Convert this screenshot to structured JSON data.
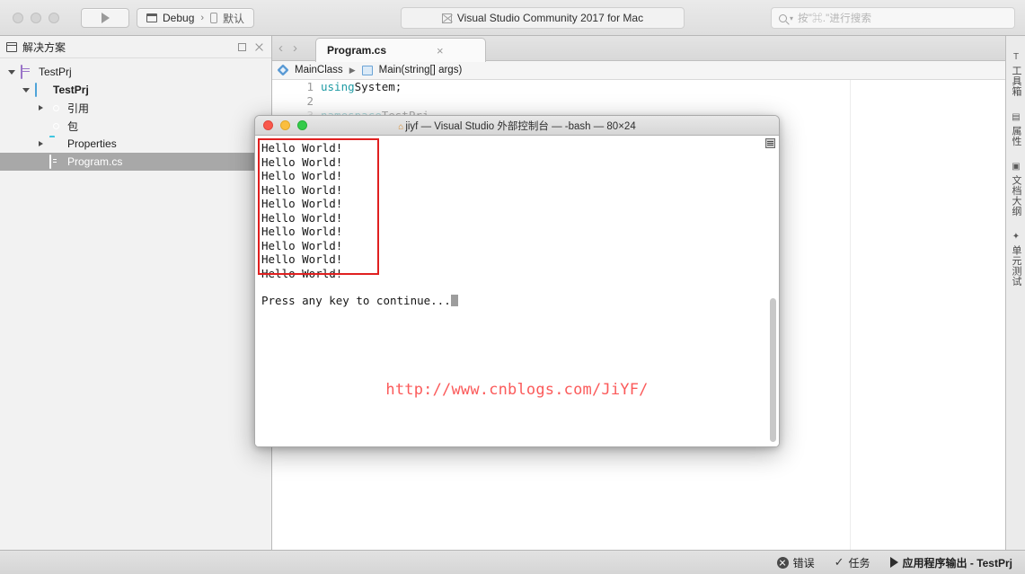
{
  "titlebar": {
    "run_button": "run-play",
    "config": {
      "build": "Debug",
      "device": "默认",
      "separator": "›"
    },
    "app_title": "Visual Studio Community 2017 for Mac",
    "search_placeholder": "按\"⌘.\"进行搜索"
  },
  "solution_pad": {
    "title": "解决方案",
    "tree": [
      {
        "label": "TestPrj",
        "icon": "solution-icon",
        "depth": 0,
        "expanded": true,
        "bold": false,
        "selected": false
      },
      {
        "label": "TestPrj",
        "icon": "project-icon",
        "depth": 1,
        "expanded": true,
        "bold": true,
        "selected": false
      },
      {
        "label": "引用",
        "icon": "references-icon",
        "depth": 2,
        "expanded": false,
        "bold": false,
        "selected": false
      },
      {
        "label": "包",
        "icon": "packages-icon",
        "depth": 2,
        "expanded": null,
        "bold": false,
        "selected": false
      },
      {
        "label": "Properties",
        "icon": "folder-icon",
        "depth": 2,
        "expanded": false,
        "bold": false,
        "selected": false
      },
      {
        "label": "Program.cs",
        "icon": "csharp-file-icon",
        "depth": 3,
        "expanded": null,
        "bold": false,
        "selected": true
      }
    ]
  },
  "editor": {
    "tab_label": "Program.cs",
    "tab_close": "×",
    "breadcrumb": {
      "class": "MainClass",
      "arrow": "▶",
      "member": "Main(string[] args)"
    },
    "code_lines": [
      {
        "number": "1",
        "keyword": "using",
        "text": " System;",
        "faded": false
      },
      {
        "number": "2",
        "keyword": "",
        "text": "",
        "faded": false
      },
      {
        "number": "3",
        "keyword": "namespace",
        "text": " TestPrj",
        "faded": true
      }
    ]
  },
  "right_bar": {
    "tabs": [
      {
        "label": "工具箱",
        "icon": "toolbox-icon",
        "glyph": "T"
      },
      {
        "label": "属性",
        "icon": "properties-icon",
        "glyph": "▤"
      },
      {
        "label": "文档大纲",
        "icon": "document-outline-icon",
        "glyph": "▣"
      },
      {
        "label": "单元测试",
        "icon": "unit-tests-icon",
        "glyph": "✦"
      }
    ]
  },
  "terminal": {
    "title": "jiyf — Visual Studio 外部控制台 — -bash — 80×24",
    "home_glyph": "⌂",
    "output_lines": [
      "Hello World!",
      "Hello World!",
      "Hello World!",
      "Hello World!",
      "Hello World!",
      "Hello World!",
      "Hello World!",
      "Hello World!",
      "Hello World!",
      "Hello World!"
    ],
    "prompt": "Press any key to continue...",
    "watermark": "http://www.cnblogs.com/JiYF/",
    "highlight_color": "#e02020"
  },
  "statusbar": {
    "errors": "错误",
    "tasks": "任务",
    "output": "应用程序输出 - TestPrj"
  }
}
